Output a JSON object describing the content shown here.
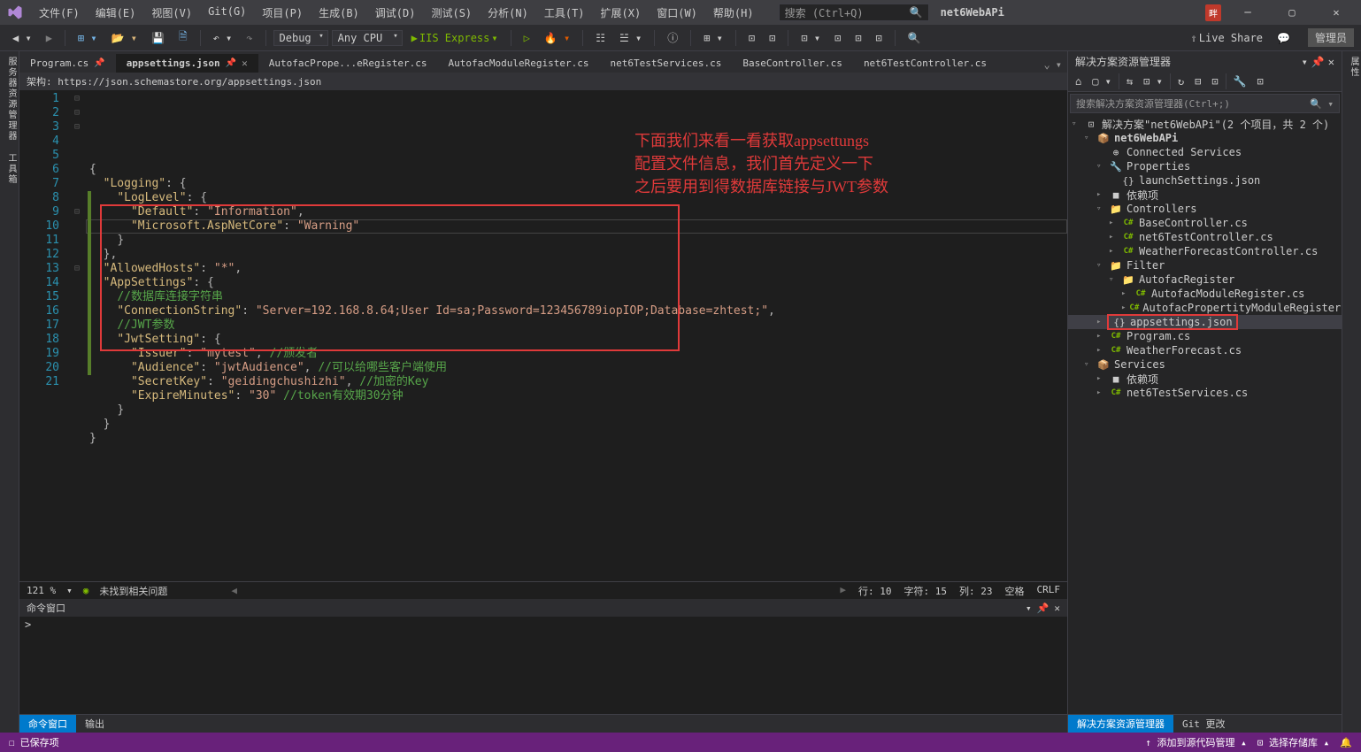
{
  "menu": [
    "文件(F)",
    "编辑(E)",
    "视图(V)",
    "Git(G)",
    "项目(P)",
    "生成(B)",
    "调试(D)",
    "测试(S)",
    "分析(N)",
    "工具(T)",
    "扩展(X)",
    "窗口(W)",
    "帮助(H)"
  ],
  "search_placeholder": "搜索 (Ctrl+Q)",
  "app_title": "net6WebAPi",
  "notif": "畔",
  "toolbar": {
    "config": "Debug",
    "platform": "Any CPU",
    "run": "IIS Express",
    "live_share": "Live Share",
    "admin": "管理员"
  },
  "side_left": "服务器资源管理器  工具箱",
  "side_right": "属性",
  "tabs": [
    {
      "label": "Program.cs",
      "pin": true
    },
    {
      "label": "appsettings.json",
      "pin": true,
      "active": true,
      "close": true
    },
    {
      "label": "AutofacPrope...eRegister.cs"
    },
    {
      "label": "AutofacModuleRegister.cs"
    },
    {
      "label": "net6TestServices.cs"
    },
    {
      "label": "BaseController.cs"
    },
    {
      "label": "net6TestController.cs"
    }
  ],
  "schema": "架构: https://json.schemastore.org/appsettings.json",
  "code_lines": [
    {
      "n": 1,
      "html": "<span class='br'>{</span>"
    },
    {
      "n": 2,
      "html": "  <span class='key'>\"Logging\"</span><span class='pun'>: {</span>"
    },
    {
      "n": 3,
      "html": "    <span class='key'>\"LogLevel\"</span><span class='pun'>: {</span>"
    },
    {
      "n": 4,
      "html": "      <span class='key'>\"Default\"</span><span class='pun'>: </span><span class='str'>\"Information\"</span><span class='pun'>,</span>"
    },
    {
      "n": 5,
      "html": "      <span class='key'>\"Microsoft.AspNetCore\"</span><span class='pun'>: </span><span class='str'>\"Warning\"</span>"
    },
    {
      "n": 6,
      "html": "    <span class='br'>}</span>"
    },
    {
      "n": 7,
      "html": "  <span class='br'>},</span>"
    },
    {
      "n": 8,
      "html": "  <span class='key'>\"AllowedHosts\"</span><span class='pun'>: </span><span class='str'>\"*\"</span><span class='pun'>,</span>"
    },
    {
      "n": 9,
      "html": "  <span class='key'>\"AppSettings\"</span><span class='pun'>: {</span>"
    },
    {
      "n": 10,
      "html": "    <span class='com'>//数据库连接字符串</span>"
    },
    {
      "n": 11,
      "html": "    <span class='key'>\"ConnectionString\"</span><span class='pun'>: </span><span class='str'>\"Server=192.168.8.64;User Id=sa;Password=123456789iopIOP;Database=zhtest;\"</span><span class='pun'>,</span>"
    },
    {
      "n": 12,
      "html": "    <span class='com'>//JWT参数</span>"
    },
    {
      "n": 13,
      "html": "    <span class='key'>\"JwtSetting\"</span><span class='pun'>: {</span>"
    },
    {
      "n": 14,
      "html": "      <span class='key'>\"Issuer\"</span><span class='pun'>: </span><span class='str'>\"mytest\"</span><span class='pun'>, </span><span class='com'>//颁发者</span>"
    },
    {
      "n": 15,
      "html": "      <span class='key'>\"Audience\"</span><span class='pun'>: </span><span class='str'>\"jwtAudience\"</span><span class='pun'>, </span><span class='com'>//可以给哪些客户端使用</span>"
    },
    {
      "n": 16,
      "html": "      <span class='key'>\"SecretKey\"</span><span class='pun'>: </span><span class='str'>\"geidingchushizhi\"</span><span class='pun'>, </span><span class='com'>//加密的Key</span>"
    },
    {
      "n": 17,
      "html": "      <span class='key'>\"ExpireMinutes\"</span><span class='pun'>: </span><span class='str'>\"30\"</span> <span class='com'>//token有效期30分钟</span>"
    },
    {
      "n": 18,
      "html": "    <span class='br'>}</span>"
    },
    {
      "n": 19,
      "html": "  <span class='br'>}</span>"
    },
    {
      "n": 20,
      "html": "<span class='br'>}</span>"
    },
    {
      "n": 21,
      "html": ""
    }
  ],
  "annotation": "下面我们来看一看获取appsettungs\n配置文件信息，我们首先定义一下\n之后要用到得数据库链接与JWT参数",
  "editor_status": {
    "zoom": "121 %",
    "issues": "未找到相关问题",
    "line": "行: 10",
    "char": "字符: 15",
    "col": "列: 23",
    "space": "空格",
    "eol": "CRLF"
  },
  "cmd_title": "命令窗口",
  "cmd_prompt": ">",
  "bottom_tabs": [
    "命令窗口",
    "输出"
  ],
  "solution": {
    "title": "解决方案资源管理器",
    "search_placeholder": "搜索解决方案资源管理器(Ctrl+;)",
    "root": "解决方案\"net6WebAPi\"(2 个项目，共 2 个)",
    "tree": [
      {
        "d": 1,
        "exp": "▿",
        "icon": "📦",
        "label": "net6WebAPi",
        "bold": true,
        "cls": "proj"
      },
      {
        "d": 2,
        "exp": "",
        "icon": "⊕",
        "label": "Connected Services"
      },
      {
        "d": 2,
        "exp": "▿",
        "icon": "🔧",
        "label": "Properties"
      },
      {
        "d": 3,
        "exp": "",
        "icon": "{}",
        "label": "launchSettings.json"
      },
      {
        "d": 2,
        "exp": "▸",
        "icon": "■",
        "label": "依赖项"
      },
      {
        "d": 2,
        "exp": "▿",
        "icon": "📁",
        "label": "Controllers",
        "cls": "folder-icon"
      },
      {
        "d": 3,
        "exp": "▸",
        "icon": "C#",
        "label": "BaseController.cs",
        "cls": "cs-icon"
      },
      {
        "d": 3,
        "exp": "▸",
        "icon": "C#",
        "label": "net6TestController.cs",
        "cls": "cs-icon"
      },
      {
        "d": 3,
        "exp": "▸",
        "icon": "C#",
        "label": "WeatherForecastController.cs",
        "cls": "cs-icon"
      },
      {
        "d": 2,
        "exp": "▿",
        "icon": "📁",
        "label": "Filter",
        "cls": "folder-icon"
      },
      {
        "d": 3,
        "exp": "▿",
        "icon": "📁",
        "label": "AutofacRegister",
        "cls": "folder-icon"
      },
      {
        "d": 4,
        "exp": "▸",
        "icon": "C#",
        "label": "AutofacModuleRegister.cs",
        "cls": "cs-icon"
      },
      {
        "d": 4,
        "exp": "▸",
        "icon": "C#",
        "label": "AutofacPropertityModuleRegister.cs",
        "cls": "cs-icon"
      },
      {
        "d": 2,
        "exp": "▸",
        "icon": "{}",
        "label": "appsettings.json",
        "selected": true,
        "redbox": true
      },
      {
        "d": 2,
        "exp": "▸",
        "icon": "C#",
        "label": "Program.cs",
        "cls": "cs-icon"
      },
      {
        "d": 2,
        "exp": "▸",
        "icon": "C#",
        "label": "WeatherForecast.cs",
        "cls": "cs-icon"
      },
      {
        "d": 1,
        "exp": "▿",
        "icon": "📦",
        "label": "Services",
        "cls": "proj"
      },
      {
        "d": 2,
        "exp": "▸",
        "icon": "■",
        "label": "依赖项"
      },
      {
        "d": 2,
        "exp": "▸",
        "icon": "C#",
        "label": "net6TestServices.cs",
        "cls": "cs-icon"
      }
    ],
    "bottom_tabs": [
      "解决方案资源管理器",
      "Git 更改"
    ]
  },
  "statusbar": {
    "ready": "已保存项",
    "add_source": "添加到源代码管理",
    "select_repo": "选择存储库"
  }
}
